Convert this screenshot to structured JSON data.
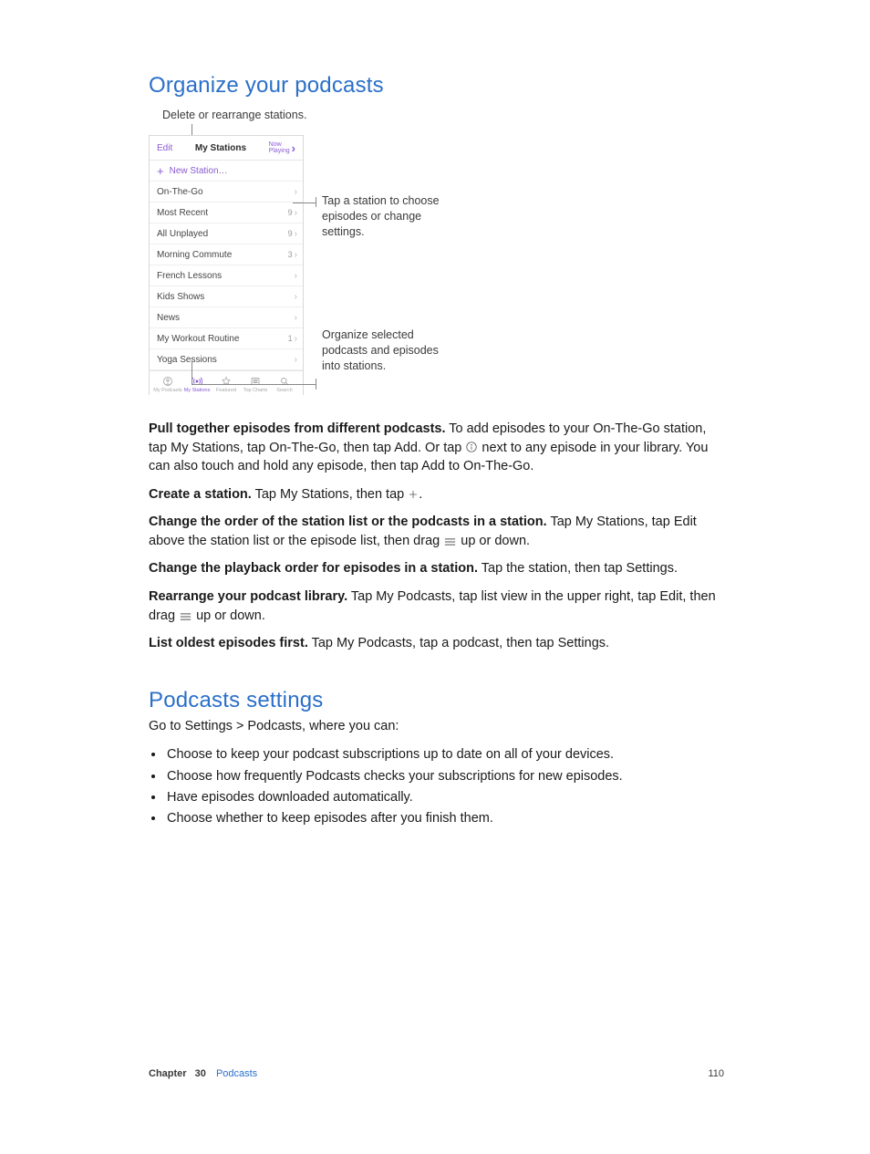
{
  "headings": {
    "organize": "Organize your podcasts",
    "settings": "Podcasts settings"
  },
  "callouts": {
    "top": "Delete or rearrange stations.",
    "mid": "Tap a station to choose episodes or change settings.",
    "bottom": "Organize selected podcasts and episodes into stations."
  },
  "phone": {
    "edit": "Edit",
    "title": "My Stations",
    "now_playing_top": "Now",
    "now_playing_bot": "Playing",
    "new_station": "New Station…",
    "rows": [
      {
        "label": "On-The-Go",
        "badge": ""
      },
      {
        "label": "Most Recent",
        "badge": "9"
      },
      {
        "label": "All Unplayed",
        "badge": "9"
      },
      {
        "label": "Morning Commute",
        "badge": "3"
      },
      {
        "label": "French Lessons",
        "badge": ""
      },
      {
        "label": "Kids Shows",
        "badge": ""
      },
      {
        "label": "News",
        "badge": ""
      },
      {
        "label": "My Workout Routine",
        "badge": "1"
      },
      {
        "label": "Yoga Sessions",
        "badge": ""
      }
    ],
    "tabs": [
      {
        "label": "My Podcasts"
      },
      {
        "label": "My Stations"
      },
      {
        "label": "Featured"
      },
      {
        "label": "Top Charts"
      },
      {
        "label": "Search"
      }
    ]
  },
  "body": {
    "p1_b": "Pull together episodes from different podcasts.",
    "p1_a": " To add episodes to your On-The-Go station, tap My Stations, tap On-The-Go, then tap Add. Or tap ",
    "p1_c": " next to any episode in your library. You can also touch and hold any episode, then tap Add to On-The-Go.",
    "p2_b": "Create a station.",
    "p2_a": " Tap My Stations, then tap ",
    "p2_c": ".",
    "p3_b": "Change the order of the station list or the podcasts in a station.",
    "p3_a": " Tap My Stations, tap Edit above the station list or the episode list, then drag ",
    "p3_c": " up or down.",
    "p4_b": "Change the playback order for episodes in a station.",
    "p4_a": " Tap the station, then tap Settings.",
    "p5_b": "Rearrange your podcast library.",
    "p5_a": " Tap My Podcasts, tap list view in the upper right, tap Edit, then drag ",
    "p5_c": " up or down.",
    "p6_b": "List oldest episodes first.",
    "p6_a": " Tap My Podcasts, tap a podcast, then tap Settings.",
    "settings_intro": "Go to Settings > Podcasts, where you can:",
    "bullets": [
      "Choose to keep your podcast subscriptions up to date on all of your devices.",
      "Choose how frequently Podcasts checks your subscriptions for new episodes.",
      "Have episodes downloaded automatically.",
      "Choose whether to keep episodes after you finish them."
    ]
  },
  "footer": {
    "chapter_word": "Chapter",
    "chapter_num": "30",
    "section": "Podcasts",
    "page": "110"
  }
}
